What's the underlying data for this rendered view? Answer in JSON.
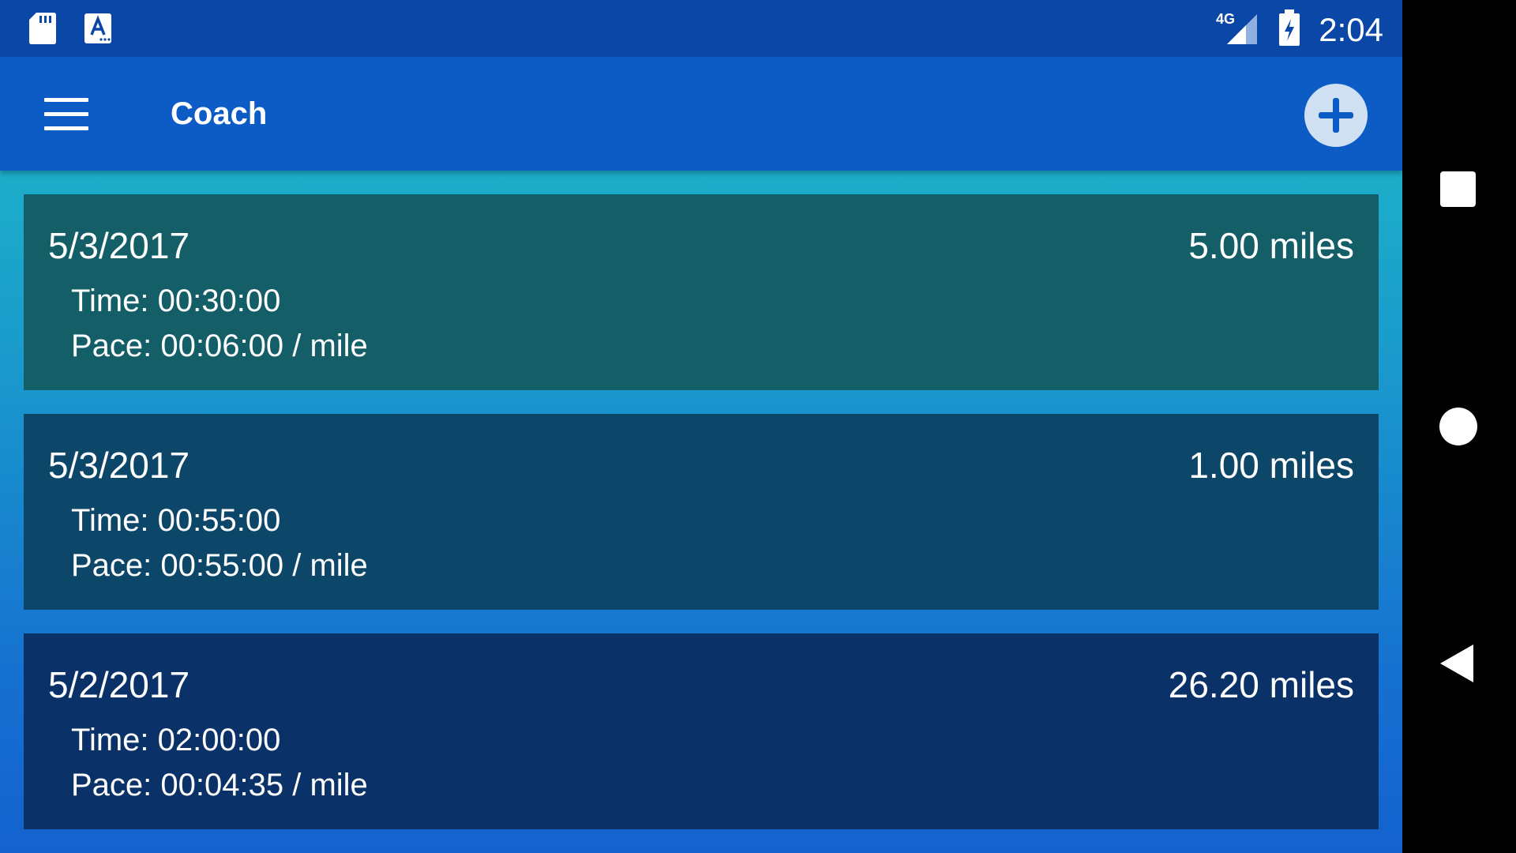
{
  "status_bar": {
    "time": "2:04",
    "network": "4G",
    "icons": [
      "sd-card-icon",
      "text-a-icon",
      "signal-icon",
      "battery-charging-icon"
    ]
  },
  "app_bar": {
    "title": "Coach",
    "menu_icon": "hamburger-menu-icon",
    "add_icon": "add-circle-icon"
  },
  "runs": [
    {
      "date": "5/3/2017",
      "distance": "5.00 miles",
      "time": "Time: 00:30:00",
      "pace": "Pace: 00:06:00 / mile"
    },
    {
      "date": "5/3/2017",
      "distance": "1.00 miles",
      "time": "Time: 00:55:00",
      "pace": "Pace: 00:55:00 / mile"
    },
    {
      "date": "5/2/2017",
      "distance": "26.20 miles",
      "time": "Time: 02:00:00",
      "pace": "Pace: 00:04:35 / mile"
    }
  ],
  "colors": {
    "status_bar": "#0b47a6",
    "app_bar": "#0d5bc5",
    "card_1": "#135e67",
    "card_2": "#0c4669",
    "card_3": "#0b3268"
  },
  "nav_bar": {
    "buttons": [
      "recents-square-icon",
      "home-circle-icon",
      "back-triangle-icon"
    ]
  }
}
